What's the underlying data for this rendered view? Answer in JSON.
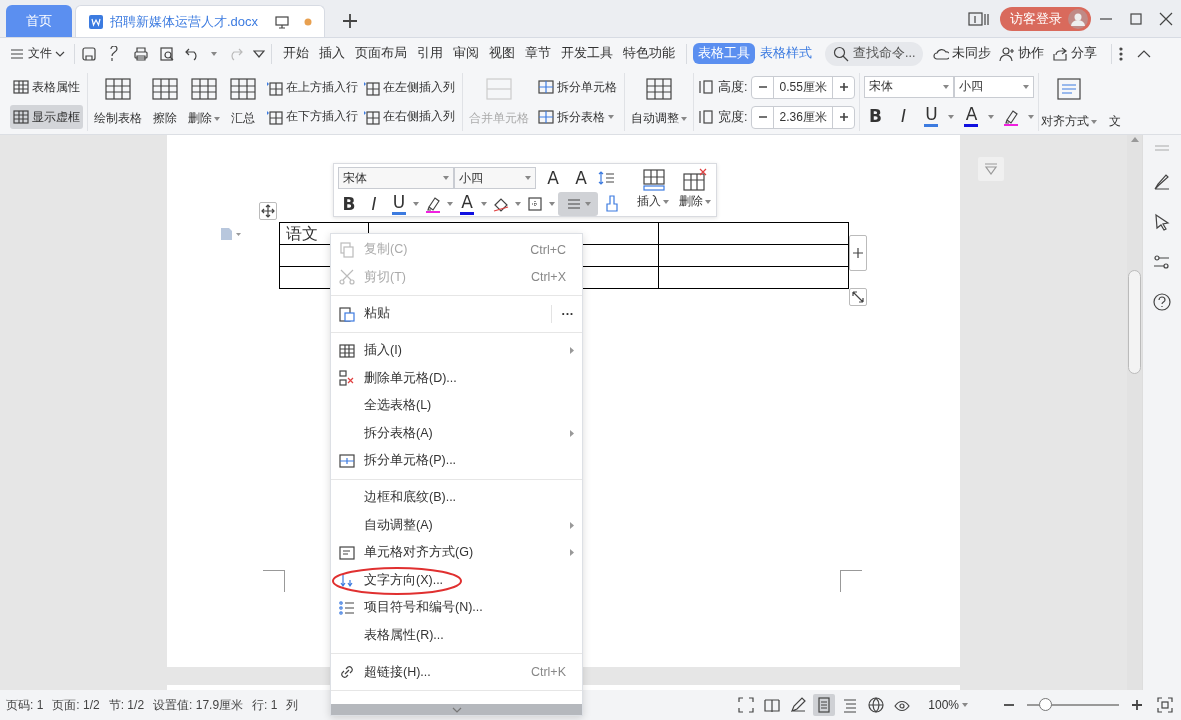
{
  "tabs": [
    {
      "label": "首页",
      "kind": "home",
      "selected": false
    },
    {
      "label": "招聘新媒体运营人才.docx",
      "kind": "doc",
      "selected": true,
      "unsaved": true
    }
  ],
  "account": {
    "label": "访客登录"
  },
  "menu_bar": {
    "file": "文件",
    "tabs": [
      {
        "label": "开始",
        "kind": "normal",
        "selected": false
      },
      {
        "label": "插入",
        "kind": "normal",
        "selected": false
      },
      {
        "label": "页面布局",
        "kind": "normal",
        "selected": false
      },
      {
        "label": "引用",
        "kind": "normal",
        "selected": false
      },
      {
        "label": "审阅",
        "kind": "normal",
        "selected": false
      },
      {
        "label": "视图",
        "kind": "normal",
        "selected": false
      },
      {
        "label": "章节",
        "kind": "normal",
        "selected": false
      },
      {
        "label": "开发工具",
        "kind": "normal",
        "selected": false
      },
      {
        "label": "特色功能",
        "kind": "normal",
        "selected": false
      },
      {
        "label": "表格工具",
        "kind": "context",
        "selected": true
      },
      {
        "label": "表格样式",
        "kind": "context",
        "selected": false
      }
    ],
    "search": {
      "placeholder": "查找命令..."
    },
    "actions": [
      "未同步",
      "协作",
      "分享"
    ]
  },
  "ribbon": {
    "table_props": [
      {
        "label": "表格属性",
        "selected": false
      },
      {
        "label": "显示虚框",
        "selected": true
      }
    ],
    "large_buttons": [
      {
        "label": "绘制表格",
        "dropdown": false
      },
      {
        "label": "擦除",
        "dropdown": false
      },
      {
        "label": "删除",
        "dropdown": true
      },
      {
        "label": "汇总",
        "dropdown": false
      }
    ],
    "insert_buttons": [
      "在上方插入行",
      "在下方插入行",
      "在左侧插入列",
      "在右侧插入列"
    ],
    "merge": {
      "label": "合并单元格",
      "disabled": true
    },
    "split_buttons": [
      {
        "label": "拆分单元格",
        "dropdown": false
      },
      {
        "label": "拆分表格",
        "dropdown": true
      }
    ],
    "autofit": {
      "label": "自动调整",
      "dropdown": true
    },
    "size_fields": [
      {
        "label": "高度:",
        "value": "0.55厘米"
      },
      {
        "label": "宽度:",
        "value": "2.36厘米"
      }
    ],
    "font": {
      "family": "宋体",
      "size": "小四"
    },
    "format_buttons": [
      {
        "kind": "bold",
        "glyph": "B"
      },
      {
        "kind": "italic",
        "glyph": "I"
      },
      {
        "kind": "underline",
        "glyph": "U"
      },
      {
        "kind": "font_color",
        "glyph": "A"
      },
      {
        "kind": "highlight"
      }
    ],
    "align": {
      "label": "对齐方式",
      "dropdown": true
    },
    "cut_label": "文"
  },
  "mini_toolbar": {
    "font": "宋体",
    "size": "小四",
    "grow_glyph": "A",
    "shrink_glyph": "A",
    "buttons": [
      {
        "kind": "bold",
        "glyph": "B",
        "selected": false
      },
      {
        "kind": "italic",
        "glyph": "I",
        "selected": false
      },
      {
        "kind": "underline",
        "glyph": "U",
        "selected": false
      },
      {
        "kind": "highlight",
        "selected": false
      },
      {
        "kind": "font_color",
        "glyph": "A",
        "selected": false
      },
      {
        "kind": "shading",
        "selected": false
      },
      {
        "kind": "border",
        "selected": false
      },
      {
        "kind": "align",
        "selected": true
      },
      {
        "kind": "painter",
        "selected": false
      }
    ],
    "insert": "插入",
    "delete": "删除"
  },
  "table": {
    "rows": [
      {
        "cells": [
          {
            "text": "语文"
          },
          {},
          {}
        ]
      },
      {
        "cells": [
          {},
          {},
          {}
        ]
      },
      {
        "cells": [
          {},
          {},
          {}
        ]
      }
    ]
  },
  "context_menu": [
    {
      "kind": "item",
      "label": "复制(C)",
      "shortcut": "Ctrl+C",
      "disabled": true,
      "submenu": false,
      "circled": false
    },
    {
      "kind": "item",
      "label": "剪切(T)",
      "shortcut": "Ctrl+X",
      "disabled": true,
      "submenu": false,
      "circled": false
    },
    {
      "kind": "separator"
    },
    {
      "kind": "item",
      "label": "粘贴",
      "more": "···",
      "disabled": false,
      "submenu": false,
      "circled": false
    },
    {
      "kind": "separator"
    },
    {
      "kind": "item",
      "label": "插入(I)",
      "disabled": false,
      "submenu": true,
      "circled": false
    },
    {
      "kind": "item",
      "label": "删除单元格(D)...",
      "disabled": false,
      "submenu": false,
      "circled": false
    },
    {
      "kind": "item",
      "label": "全选表格(L)",
      "disabled": false,
      "submenu": false,
      "circled": false
    },
    {
      "kind": "item",
      "label": "拆分表格(A)",
      "disabled": false,
      "submenu": true,
      "circled": false
    },
    {
      "kind": "item",
      "label": "拆分单元格(P)...",
      "disabled": false,
      "submenu": false,
      "circled": false
    },
    {
      "kind": "separator"
    },
    {
      "kind": "item",
      "label": "边框和底纹(B)...",
      "disabled": false,
      "submenu": false,
      "circled": false
    },
    {
      "kind": "item",
      "label": "自动调整(A)",
      "disabled": false,
      "submenu": true,
      "circled": false
    },
    {
      "kind": "item",
      "label": "单元格对齐方式(G)",
      "disabled": false,
      "submenu": true,
      "circled": false
    },
    {
      "kind": "item",
      "label": "文字方向(X)...",
      "disabled": false,
      "submenu": false,
      "circled": true
    },
    {
      "kind": "item",
      "label": "项目符号和编号(N)...",
      "disabled": false,
      "submenu": false,
      "circled": false
    },
    {
      "kind": "item",
      "label": "表格属性(R)...",
      "disabled": false,
      "submenu": false,
      "circled": false
    },
    {
      "kind": "separator"
    },
    {
      "kind": "item",
      "label": "超链接(H)...",
      "shortcut": "Ctrl+K",
      "disabled": false,
      "submenu": false,
      "circled": false
    },
    {
      "kind": "separator"
    }
  ],
  "status_bar": {
    "items": [
      "页码: 1",
      "页面: 1/2",
      "节: 1/2",
      "设置值: 17.9厘米",
      "行: 1",
      "列"
    ],
    "views": [
      {
        "selected": false
      },
      {
        "selected": false
      },
      {
        "selected": false
      },
      {
        "selected": true
      },
      {
        "selected": false
      },
      {
        "selected": false
      },
      {
        "selected": false
      }
    ],
    "zoom": "100%",
    "zoom_slider": {
      "level": 0.2
    }
  }
}
